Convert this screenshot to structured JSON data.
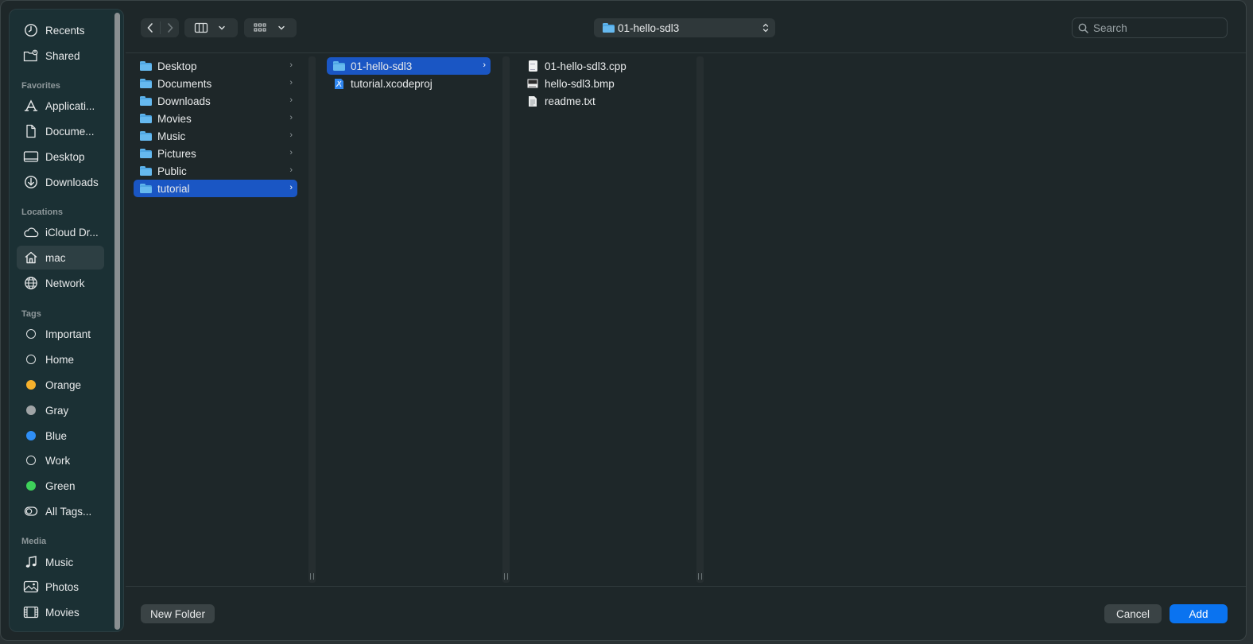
{
  "window": {
    "accent": "#0a73f0",
    "selection": "#1a56c4"
  },
  "sidebar": {
    "top_items": [
      {
        "label": "Recents",
        "icon": "clock-icon"
      },
      {
        "label": "Shared",
        "icon": "shared-folder-icon"
      }
    ],
    "favorites_header": "Favorites",
    "favorites": [
      {
        "label": "Applicati...",
        "icon": "applications-icon"
      },
      {
        "label": "Docume...",
        "icon": "document-icon"
      },
      {
        "label": "Desktop",
        "icon": "desktop-icon"
      },
      {
        "label": "Downloads",
        "icon": "download-icon"
      }
    ],
    "locations_header": "Locations",
    "locations": [
      {
        "label": "iCloud Dr...",
        "icon": "cloud-icon"
      },
      {
        "label": "mac",
        "icon": "home-icon",
        "active": true
      },
      {
        "label": "Network",
        "icon": "globe-icon"
      }
    ],
    "tags_header": "Tags",
    "tags": [
      {
        "label": "Important",
        "color": "none"
      },
      {
        "label": "Home",
        "color": "none"
      },
      {
        "label": "Orange",
        "color": "#f6b12c"
      },
      {
        "label": "Gray",
        "color": "#a0a4a6"
      },
      {
        "label": "Blue",
        "color": "#2f8ff6"
      },
      {
        "label": "Work",
        "color": "none"
      },
      {
        "label": "Green",
        "color": "#3ed15a"
      },
      {
        "label": "All Tags...",
        "color": "all"
      }
    ],
    "media_header": "Media",
    "media": [
      {
        "label": "Music",
        "icon": "music-note-icon"
      },
      {
        "label": "Photos",
        "icon": "photos-icon"
      },
      {
        "label": "Movies",
        "icon": "film-icon"
      }
    ]
  },
  "toolbar": {
    "path": "01-hello-sdl3",
    "search_placeholder": "Search"
  },
  "columns": {
    "col1": [
      {
        "label": "Desktop"
      },
      {
        "label": "Documents"
      },
      {
        "label": "Downloads"
      },
      {
        "label": "Movies"
      },
      {
        "label": "Music"
      },
      {
        "label": "Pictures"
      },
      {
        "label": "Public"
      },
      {
        "label": "tutorial",
        "selected": true
      }
    ],
    "col2": [
      {
        "label": "01-hello-sdl3",
        "type": "folder",
        "selected": true
      },
      {
        "label": "tutorial.xcodeproj",
        "type": "xcodeproj"
      }
    ],
    "col3": [
      {
        "label": "01-hello-sdl3.cpp",
        "type": "cpp"
      },
      {
        "label": "hello-sdl3.bmp",
        "type": "bmp"
      },
      {
        "label": "readme.txt",
        "type": "txt"
      }
    ]
  },
  "bottom": {
    "new_folder": "New Folder",
    "cancel": "Cancel",
    "add": "Add"
  }
}
